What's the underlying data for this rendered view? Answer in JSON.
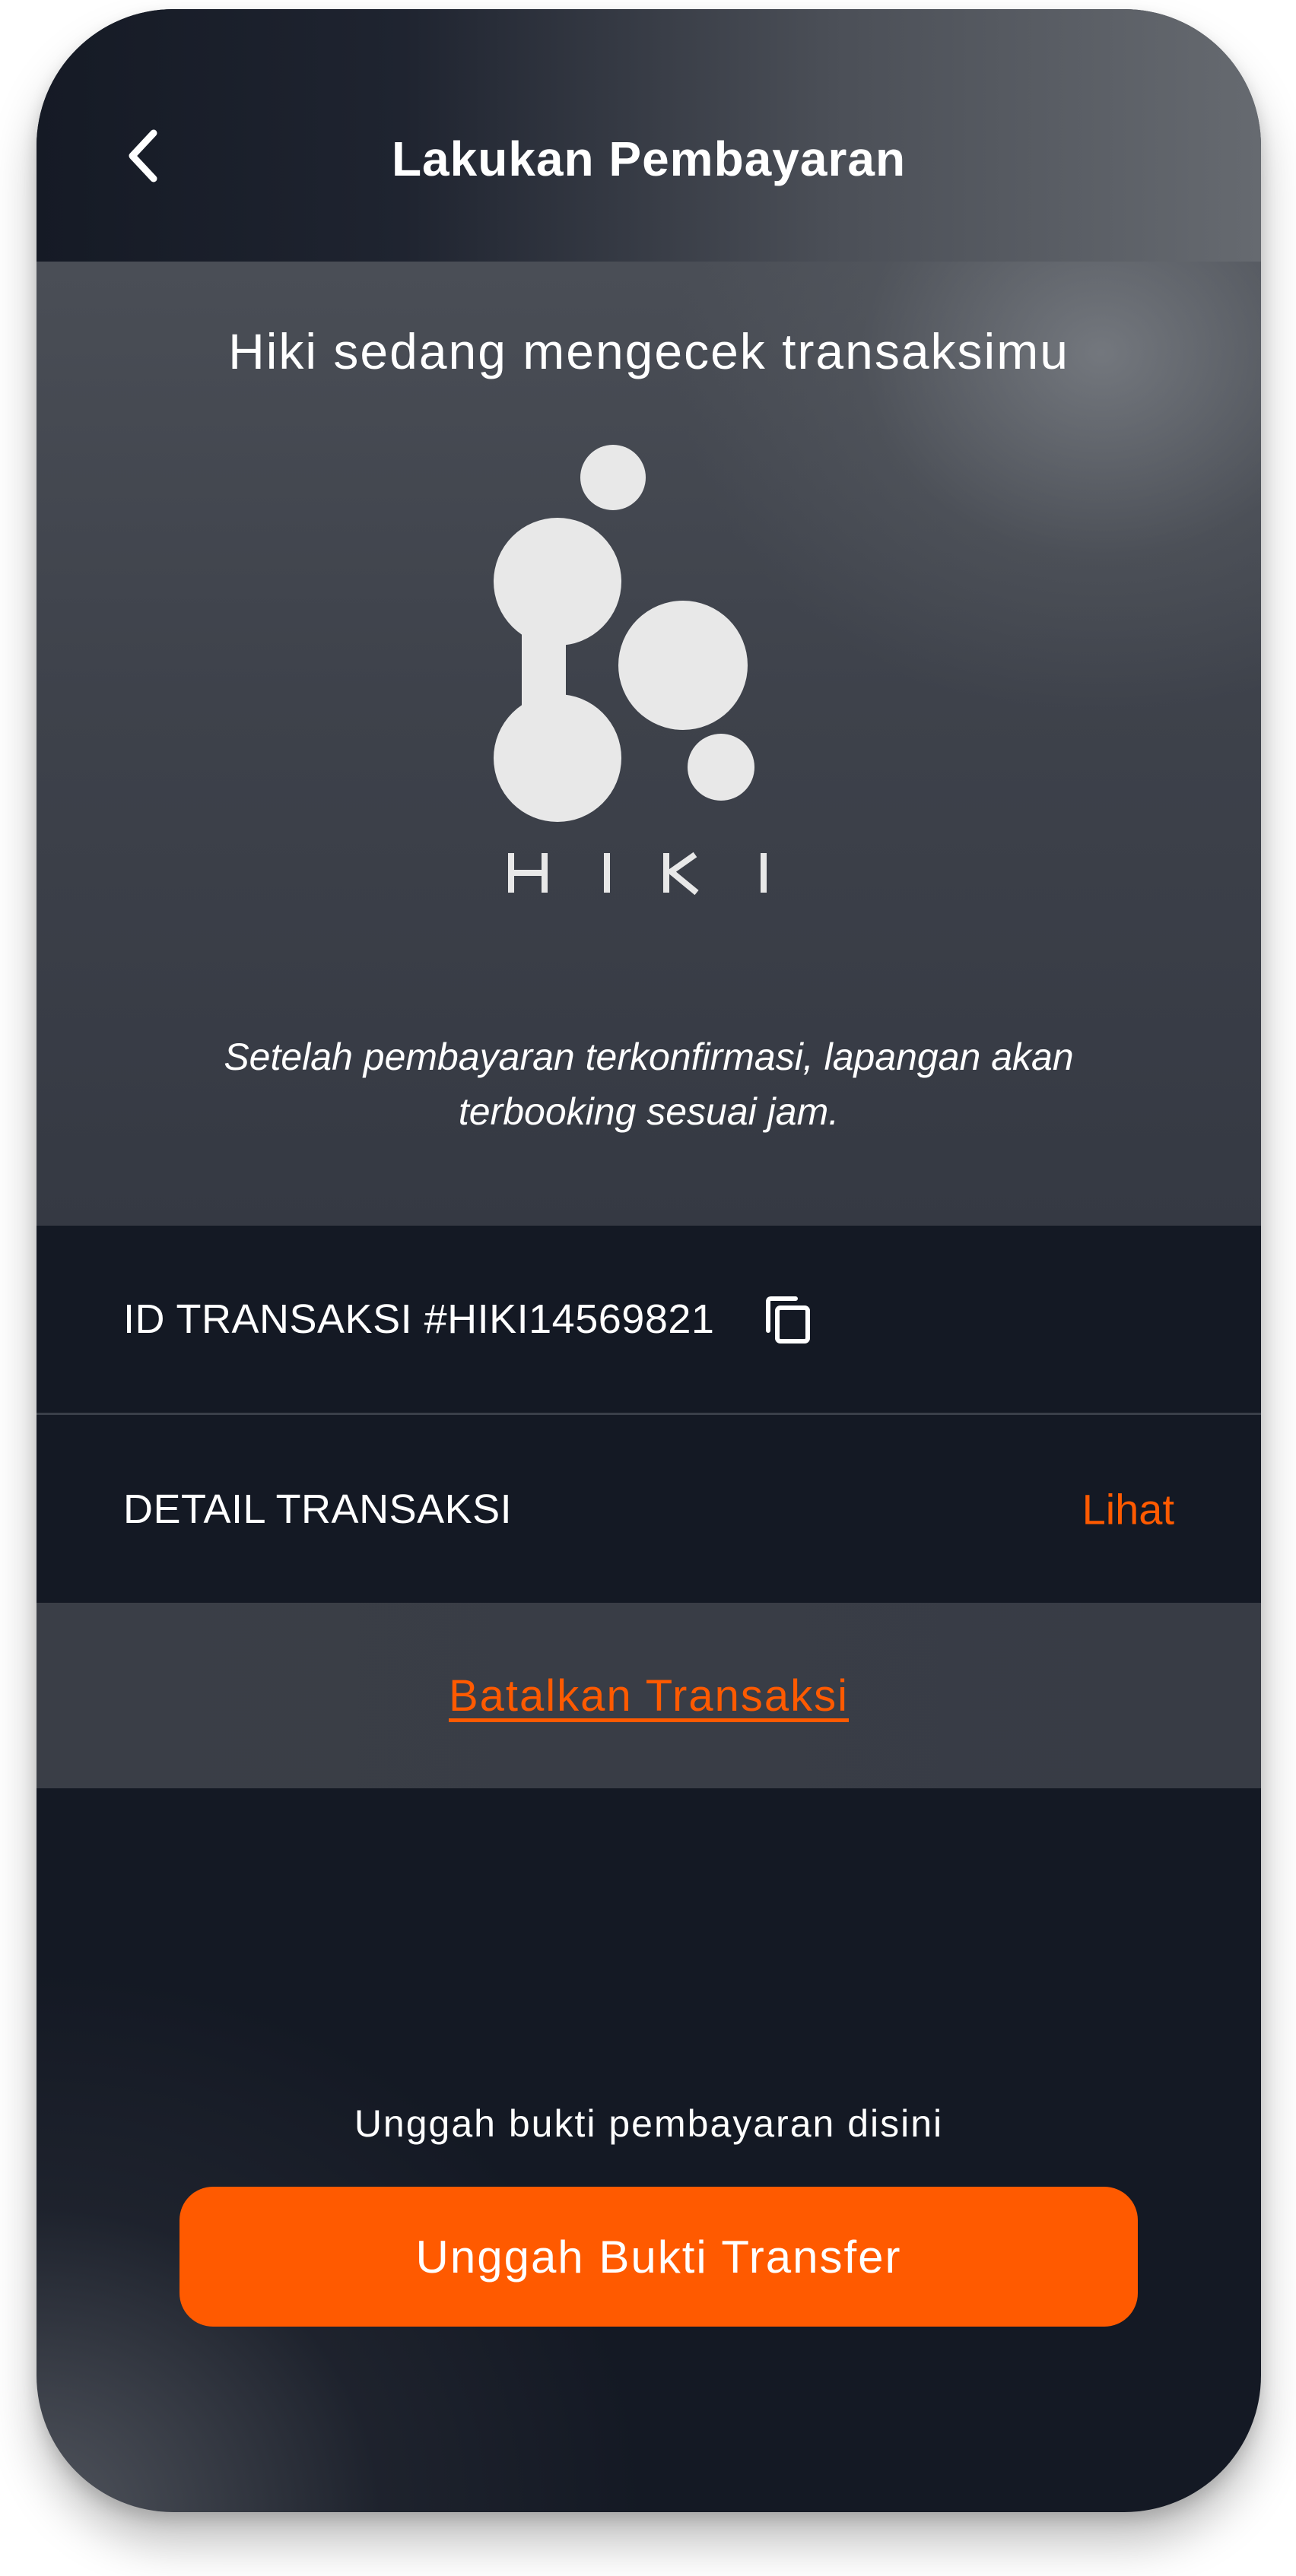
{
  "header": {
    "title": "Lakukan Pembayaran",
    "back_icon": "chevron-left-icon"
  },
  "status": {
    "heading": "Hiki sedang mengecek transaksimu",
    "logo_text": "HIKI",
    "note": "Setelah pembayaran terkonfirmasi, lapangan akan terbooking sesuai jam."
  },
  "transaction": {
    "id_label": "ID TRANSAKSI #HIKI14569821",
    "copy_icon": "copy-icon",
    "detail_label": "DETAIL TRANSAKSI",
    "detail_action": "Lihat",
    "cancel_label": "Batalkan Transaksi"
  },
  "upload": {
    "hint": "Unggah bukti pembayaran disini",
    "button_label": "Unggah Bukti Transfer"
  },
  "colors": {
    "accent": "#ff5a00",
    "background_dark": "#141924",
    "panel_gray": "#3e424b",
    "text_light": "#ffffff"
  }
}
